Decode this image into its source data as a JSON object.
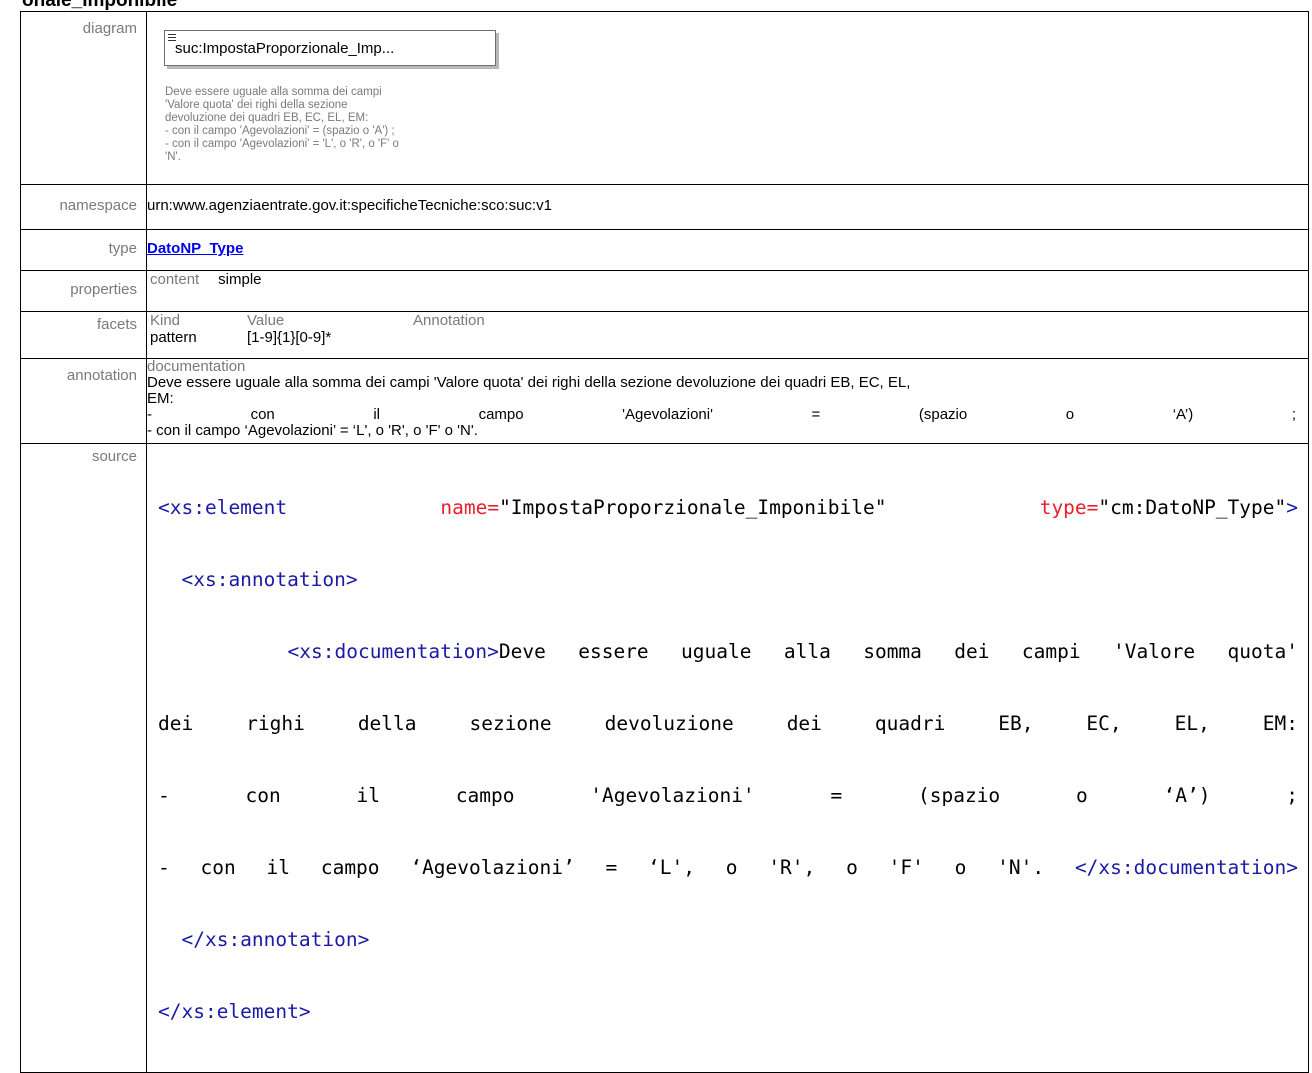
{
  "heading": "onale_Imponibile",
  "labels": {
    "diagram": "diagram",
    "namespace": "namespace",
    "type": "type",
    "properties": "properties",
    "facets": "facets",
    "annotation": "annotation",
    "source": "source"
  },
  "diagram": {
    "box_title": "suc:ImpostaProporzionale_Imp...",
    "note_lines": [
      "Deve essere uguale alla somma dei campi",
      "'Valore quota' dei righi della sezione",
      "devoluzione dei quadri EB, EC, EL, EM:",
      "- con il campo 'Agevolazioni' = (spazio o 'A') ;",
      "- con il campo 'Agevolazioni' = 'L', o 'R', o 'F' o",
      "'N'."
    ]
  },
  "namespace": "urn:www.agenziaentrate.gov.it:specificheTecniche:sco:suc:v1",
  "type_link": "DatoNP_Type",
  "properties": {
    "key": "content",
    "value": "simple"
  },
  "facets": {
    "headers": [
      "Kind",
      "Value",
      "Annotation"
    ],
    "row": {
      "kind": "pattern",
      "value": "[1-9]{1}[0-9]*",
      "annotation": ""
    }
  },
  "annotation": {
    "header": "documentation",
    "line1": "Deve essere uguale alla somma dei campi 'Valore quota' dei righi della sezione devoluzione dei quadri EB, EC, EL,",
    "line2": "EM:",
    "line3": "- con il campo 'Agevolazioni' = (spazio o ‘A’) ;",
    "line4": "- con il campo ‘Agevolazioni’ = ‘L', o 'R', o 'F' o 'N'."
  },
  "source": {
    "l1_open": "<xs:element",
    "l1_attr1": "name=",
    "l1_val1": "\"ImpostaProporzionale_Imponibile\"",
    "l1_attr2": "type=",
    "l1_val2": "\"cm:DatoNP_Type\"",
    "l1_close": ">",
    "l2": "<xs:annotation>",
    "l3_tag": "<xs:documentation>",
    "l3_text": "Deve essere uguale alla somma dei campi 'Valore quota'",
    "l4": "dei righi della sezione devoluzione dei quadri EB, EC, EL, EM:",
    "l5": "- con il campo 'Agevolazioni' = (spazio o ‘A’) ;",
    "l6_text": "- con il campo ‘Agevolazioni’ = ‘L', o 'R', o 'F' o 'N'. ",
    "l6_tag": "</xs:documentation>",
    "l7": "</xs:annotation>",
    "l8": "</xs:element>"
  }
}
